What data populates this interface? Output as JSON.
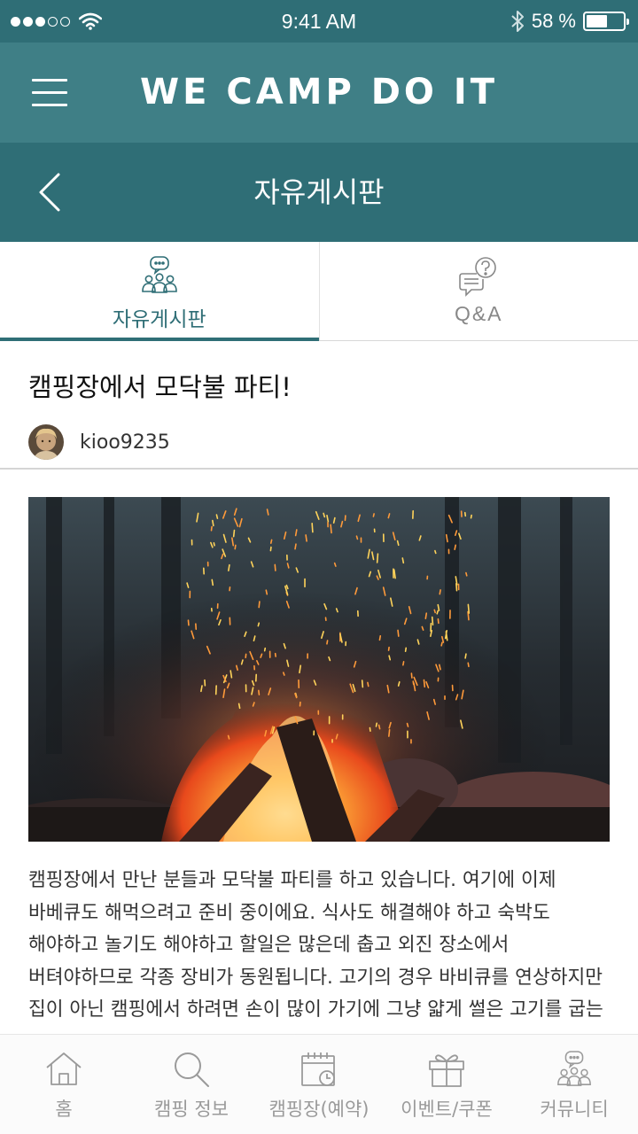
{
  "status_bar": {
    "time": "9:41 AM",
    "battery_text": "58 %",
    "battery_level": 0.58,
    "signal_bars_filled": 3,
    "signal_bars_total": 5,
    "icons": [
      "signal-dots-icon",
      "wifi-icon",
      "bluetooth-icon",
      "battery-icon"
    ]
  },
  "header": {
    "app_title": "WE CAMP DO IT",
    "menu_icon": "hamburger-menu-icon"
  },
  "sub_header": {
    "title": "자유게시판",
    "back_icon": "chevron-left-icon"
  },
  "tabs": [
    {
      "label": "자유게시판",
      "icon": "community-chat-icon",
      "active": true
    },
    {
      "label": "Q&A",
      "icon": "question-chat-icon",
      "active": false
    }
  ],
  "post": {
    "title": "캠핑장에서 모닥불 파티!",
    "author": "kioo9235",
    "image_alt": "campfire with sparks",
    "body": "캠핑장에서 만난 분들과 모닥불 파티를 하고 있습니다. 여기에 이제 바베큐도 해먹으려고 준비 중이에요. 식사도 해결해야 하고 숙박도 해야하고 놀기도 해야하고 할일은 많은데 춥고 외진 장소에서 버텨야하므로 각종 장비가 동원됩니다. 고기의 경우 바비큐를 연상하지만 집이 아닌 캠핑에서 하려면 손이 많이 가기에 그냥 얇게 썰은 고기를 굽는 게 제일 좋습니"
  },
  "bottom_nav": [
    {
      "label": "홈",
      "icon": "home-icon"
    },
    {
      "label": "캠핑 정보",
      "icon": "search-icon"
    },
    {
      "label": "캠핑장(예약)",
      "icon": "calendar-clock-icon"
    },
    {
      "label": "이벤트/쿠폰",
      "icon": "gift-icon"
    },
    {
      "label": "커뮤니티",
      "icon": "community-icon"
    }
  ],
  "colors": {
    "status_bar": "#2f6e76",
    "header": "#3f7f86",
    "sub_header": "#2f6e76",
    "accent": "#2f6e76",
    "nav_gray": "#9a9a9a"
  }
}
